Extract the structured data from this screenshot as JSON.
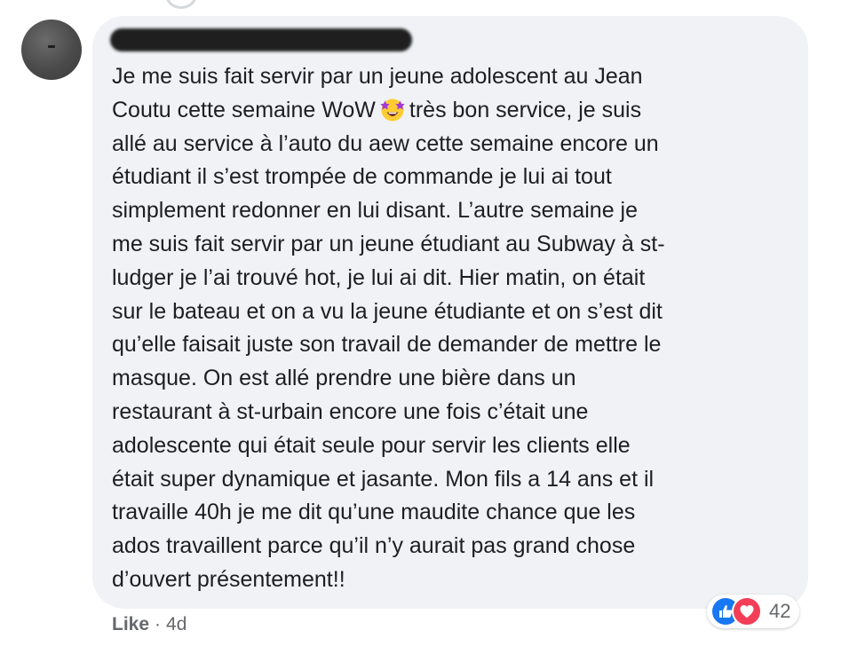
{
  "comment": {
    "lines": [
      "Je me suis fait servir par un jeune adolescent au Jean",
      "Coutu cette semaine WoW",
      "très bon service, je suis",
      "allé au service à l’auto du aew cette semaine encore un",
      "étudiant il s’est trompée de commande je lui ai tout",
      "simplement redonner en lui disant. L’autre semaine je",
      "me suis fait servir par un jeune étudiant au Subway à st-",
      "ludger je l’ai trouvé hot, je lui ai dit. Hier matin, on était",
      "sur le bateau et on a vu la jeune étudiante et on s’est dit",
      "qu’elle faisait juste son travail de demander de mettre le",
      "masque. On est allé prendre une bière dans un",
      "restaurant à st-urbain encore une fois c’était une",
      "adolescente qui était seule pour servir les clients elle",
      "était super dynamique et jasante. Mon fils a 14 ans et il",
      "travaille 40h je me dit qu’une maudite chance que les",
      "ados travaillent parce qu’il n’y aurait pas grand chose",
      "d’ouvert présentement!!"
    ],
    "emoji_icon": "star-struck-emoji-icon"
  },
  "reactions": {
    "icons": [
      "like-reaction-icon",
      "love-reaction-icon"
    ],
    "count": "42",
    "like_color": "#1877f2",
    "love_color": "#f33e58"
  },
  "actions": {
    "like_label": "Like",
    "separator": "·",
    "timestamp": "4d"
  },
  "colors": {
    "bubble_bg": "#f0f2f5",
    "text": "#1c1e21",
    "meta": "#65676b"
  }
}
